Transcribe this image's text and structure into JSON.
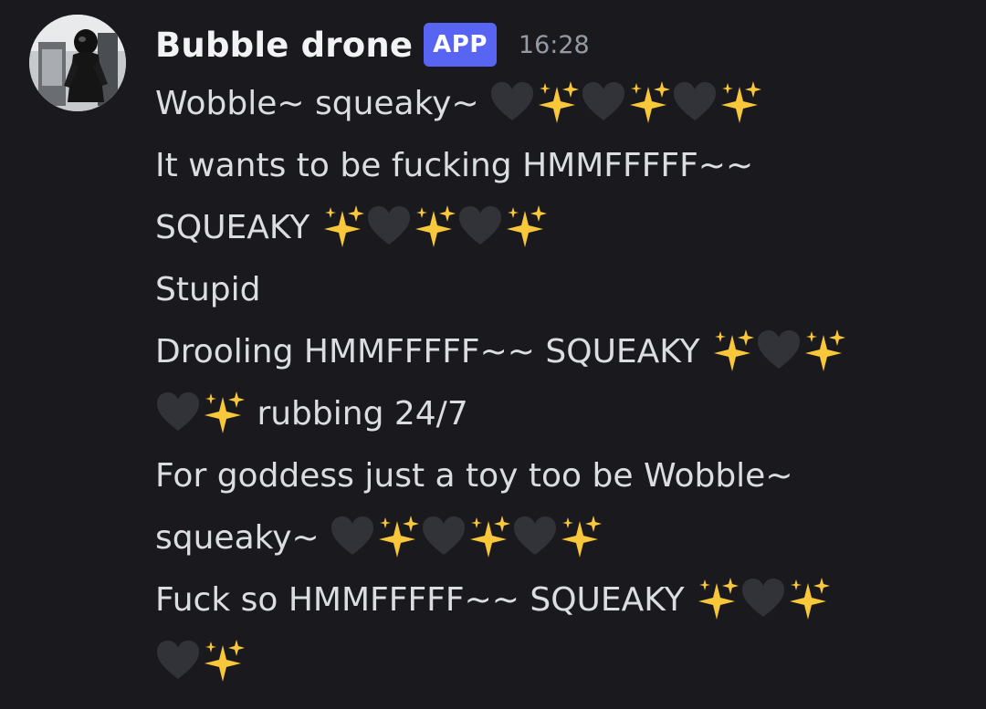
{
  "message": {
    "author": "Bubble drone",
    "badge": "APP",
    "timestamp": "16:28",
    "lines": [
      {
        "text": "Wobble~ squeaky~ ",
        "emojis": [
          "black-heart",
          "sparkles",
          "black-heart",
          "sparkles",
          "black-heart",
          "sparkles"
        ]
      },
      {
        "text": "It wants to be fucking HMMFFFFF~~",
        "emojis": []
      },
      {
        "text": "SQUEAKY ",
        "emojis": [
          "sparkles",
          "black-heart",
          "sparkles",
          "black-heart",
          "sparkles"
        ]
      },
      {
        "text": "Stupid",
        "emojis": []
      },
      {
        "text": "Drooling HMMFFFFF~~ SQUEAKY ",
        "emojis": [
          "sparkles",
          "black-heart",
          "sparkles"
        ]
      },
      {
        "text": " rubbing 24/7",
        "emojis_before": [
          "black-heart",
          "sparkles"
        ]
      },
      {
        "text": "For goddess just a toy too be Wobble~",
        "emojis": []
      },
      {
        "text": "squeaky~ ",
        "emojis": [
          "black-heart",
          "sparkles",
          "black-heart",
          "sparkles",
          "black-heart",
          "sparkles"
        ]
      },
      {
        "text": "Fuck so HMMFFFFF~~ SQUEAKY ",
        "emojis": [
          "sparkles",
          "black-heart",
          "sparkles"
        ]
      },
      {
        "text": "",
        "emojis": [
          "black-heart",
          "sparkles"
        ]
      }
    ]
  },
  "colors": {
    "background": "#1a1a1e",
    "text": "#dbdee1",
    "username": "#f2f3f5",
    "badge": "#5865f2",
    "timestamp": "#949ba4",
    "heart": "#313338",
    "sparkle": "#f9c73a"
  }
}
